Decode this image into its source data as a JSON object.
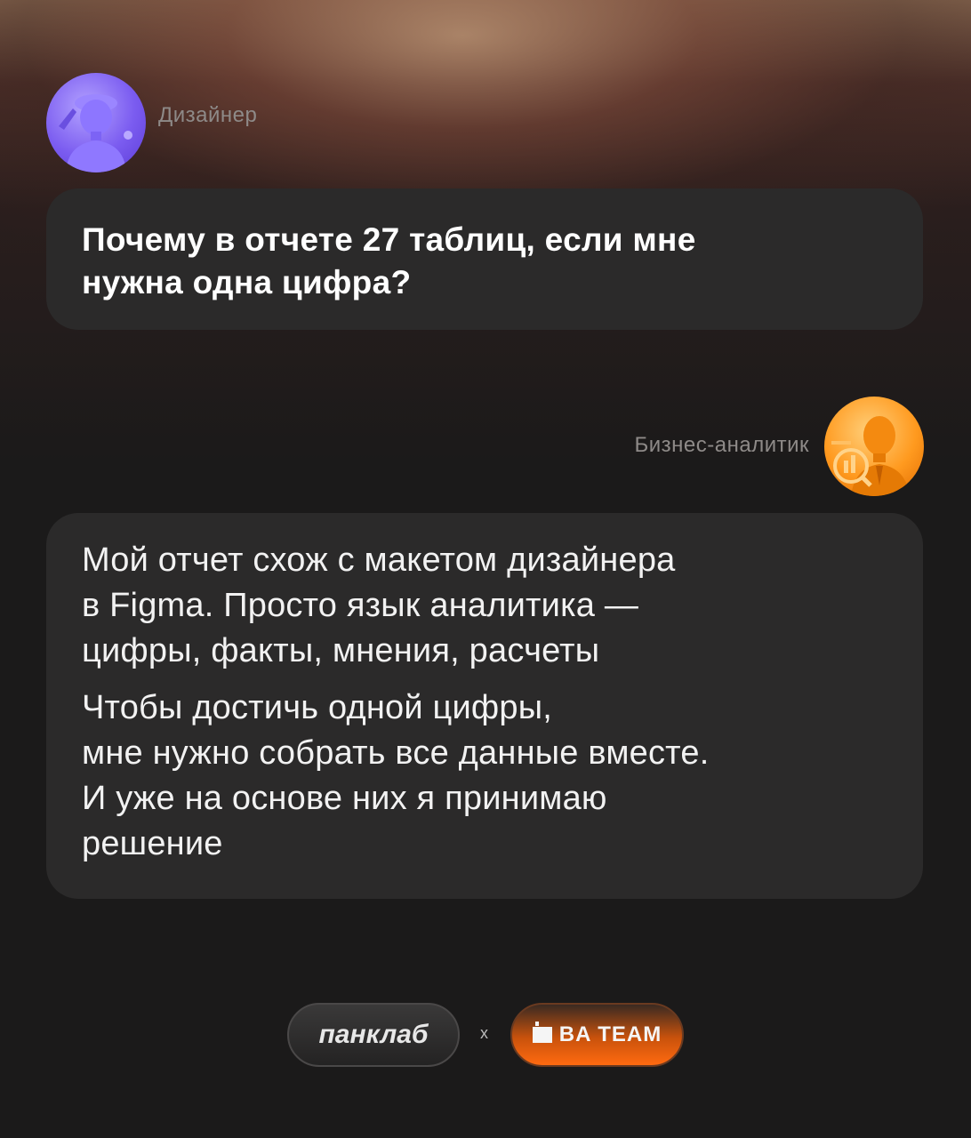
{
  "messages": [
    {
      "sender": "Дизайнер",
      "avatar_icon": "designer-avatar-icon",
      "lines": [
        "Почему в отчете 27 таблиц, если мне",
        "нужна одна цифра?"
      ]
    },
    {
      "sender": "Бизнес-аналитик",
      "avatar_icon": "analyst-avatar-icon",
      "paragraphs": [
        [
          "Мой отчет схож с макетом дизайнера",
          "в Figma. Просто язык аналитика —",
          "цифры, факты, мнения, расчеты"
        ],
        [
          "Чтобы достичь одной цифры,",
          "мне нужно собрать все данные вместе.",
          "И уже на основе них я принимаю",
          "решение"
        ]
      ]
    }
  ],
  "footer": {
    "brand_left": "панклаб",
    "separator": "х",
    "brand_right": "BA TEAM"
  },
  "colors": {
    "bubble": "#2b2a2a",
    "designer_accent": "#7b5cf0",
    "analyst_accent": "#ff9a1f",
    "ba_team_accent": "#ff6a10"
  }
}
